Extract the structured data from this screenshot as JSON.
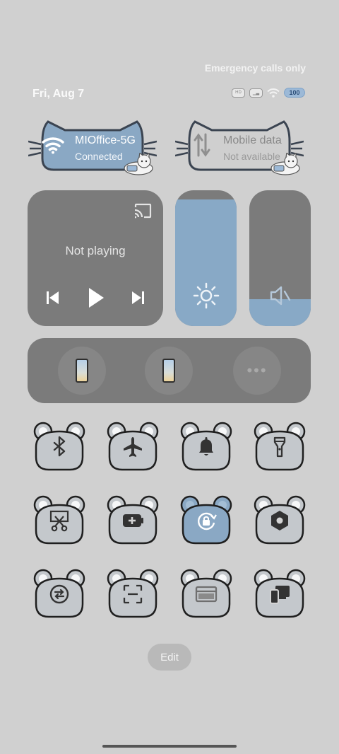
{
  "status_bar": {
    "emergency_text": "Emergency calls only",
    "date": "Fri, Aug 7",
    "battery_level": "100"
  },
  "wifi_card": {
    "title": "MIOffice-5G",
    "subtitle": "Connected",
    "icon": "wifi-icon",
    "active_color": "#8aa8c4"
  },
  "mobile_card": {
    "title": "Mobile data",
    "subtitle": "Not available",
    "icon": "mobile-data-icon",
    "inactive_color": "#cfcfcf"
  },
  "media": {
    "status": "Not playing",
    "icons": [
      "cast-icon",
      "previous-icon",
      "play-icon",
      "next-icon"
    ]
  },
  "brightness": {
    "level": 0.93,
    "icon": "sun-icon"
  },
  "volume": {
    "level": 0.2,
    "icon": "speaker-muted-icon"
  },
  "devices": {
    "icons": [
      "phone-icon",
      "phone-icon",
      "more-icon"
    ]
  },
  "toggles": [
    {
      "name": "bluetooth",
      "icon": "bluetooth-icon",
      "active": false
    },
    {
      "name": "airplane",
      "icon": "airplane-icon",
      "active": false
    },
    {
      "name": "ring",
      "icon": "bell-icon",
      "active": false
    },
    {
      "name": "flashlight",
      "icon": "flashlight-icon",
      "active": false
    },
    {
      "name": "screenshot",
      "icon": "scissors-icon",
      "active": false
    },
    {
      "name": "battery-saver",
      "icon": "battery-plus-icon",
      "active": false
    },
    {
      "name": "rotation-lock",
      "icon": "rotation-lock-icon",
      "active": true
    },
    {
      "name": "settings",
      "icon": "hexagon-icon",
      "active": false
    },
    {
      "name": "sync",
      "icon": "sync-icon",
      "active": false
    },
    {
      "name": "scanner",
      "icon": "scan-icon",
      "active": false
    },
    {
      "name": "card",
      "icon": "card-icon",
      "active": false
    },
    {
      "name": "cast",
      "icon": "devices-icon",
      "active": false
    }
  ],
  "edit_label": "Edit"
}
